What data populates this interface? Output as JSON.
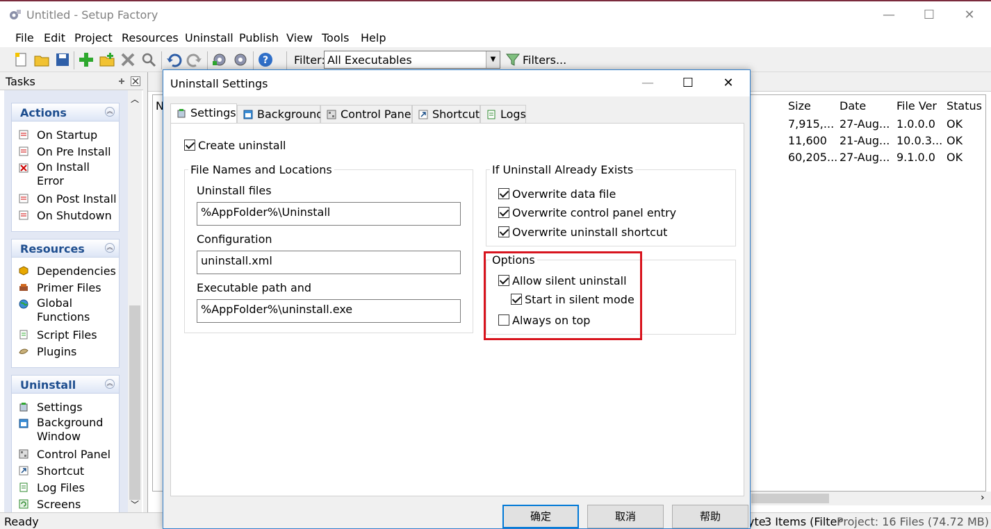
{
  "app": {
    "title": "Untitled - Setup Factory",
    "window_controls": [
      "—",
      "☐",
      "✕"
    ]
  },
  "menu": [
    "File",
    "Edit",
    "Project",
    "Resources",
    "Uninstall",
    "Publish",
    "View",
    "Tools",
    "Help"
  ],
  "toolbar": {
    "filter_label": "Filter:",
    "filter_value": "All Executables",
    "filters_button": "Filters..."
  },
  "tasks": {
    "title": "Tasks",
    "groups": [
      {
        "title": "Actions",
        "items": [
          "On Startup",
          "On Pre Install",
          "On Install Error",
          "On Post Install",
          "On Shutdown"
        ]
      },
      {
        "title": "Resources",
        "items": [
          "Dependencies",
          "Primer Files",
          "Global Functions",
          "Script Files",
          "Plugins"
        ]
      },
      {
        "title": "Uninstall",
        "items": [
          "Settings",
          "Background Window",
          "Control Panel",
          "Shortcut",
          "Log Files",
          "Screens"
        ]
      }
    ]
  },
  "filelist": {
    "col_name_partial": "N",
    "columns": [
      "Size",
      "Date",
      "File Ver",
      "Status"
    ],
    "rows": [
      [
        "7,915,...",
        "27-Aug...",
        "1.0.0.0",
        "OK"
      ],
      [
        "11,600",
        "21-Aug...",
        "10.0.3...",
        "OK"
      ],
      [
        "60,205...",
        "27-Aug...",
        "9.1.0.0",
        "OK"
      ]
    ]
  },
  "statusbar": {
    "ready": "Ready",
    "partial": "yte",
    "items": "3 Items (Filter",
    "project": "Project: 16 Files (74.72 MB)"
  },
  "dialog": {
    "title": "Uninstall Settings",
    "tabs": [
      "Settings",
      "Background",
      "Control Panel",
      "Shortcut",
      "Logs"
    ],
    "create_uninstall": {
      "label": "Create uninstall",
      "checked": true
    },
    "file_names": {
      "legend": "File Names and Locations",
      "uninstall_files_label": "Uninstall files",
      "uninstall_files_value": "%AppFolder%\\Uninstall",
      "configuration_label": "Configuration",
      "configuration_value": "uninstall.xml",
      "exe_path_label": "Executable path and",
      "exe_path_value": "%AppFolder%\\uninstall.exe"
    },
    "if_exists": {
      "legend": "If Uninstall Already Exists",
      "options": [
        {
          "label": "Overwrite data file",
          "checked": true
        },
        {
          "label": "Overwrite control panel entry",
          "checked": true
        },
        {
          "label": "Overwrite uninstall shortcut",
          "checked": true
        }
      ]
    },
    "options": {
      "legend": "Options",
      "allow_silent": {
        "label": "Allow silent uninstall",
        "checked": true
      },
      "start_silent": {
        "label": "Start in silent mode",
        "checked": true
      },
      "always_on_top": {
        "label": "Always on top",
        "checked": false
      }
    },
    "buttons": {
      "ok": "确定",
      "cancel": "取消",
      "help": "帮助"
    },
    "highlight_color": "#d8141e"
  }
}
